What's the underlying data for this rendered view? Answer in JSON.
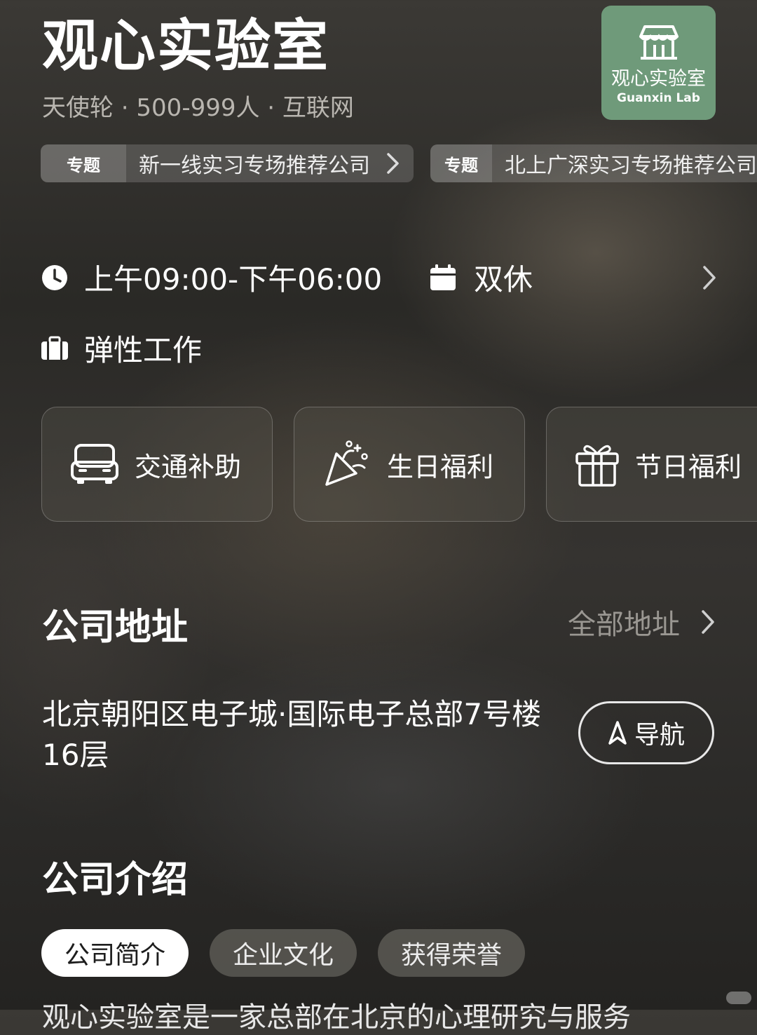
{
  "company": {
    "name": "观心实验室",
    "meta": "天使轮 · 500-999人 · 互联网",
    "logo_cn": "观心实验室",
    "logo_en": "Guanxin Lab"
  },
  "topics": [
    {
      "tag": "专题",
      "text": "新一线实习专场推荐公司"
    },
    {
      "tag": "专题",
      "text": "北上广深实习专场推荐公司"
    }
  ],
  "work": {
    "hours": "上午09:00-下午06:00",
    "days": "双休",
    "mode": "弹性工作"
  },
  "benefits": [
    {
      "label": "交通补助",
      "icon": "car-icon"
    },
    {
      "label": "生日福利",
      "icon": "party-popper-icon"
    },
    {
      "label": "节日福利",
      "icon": "gift-icon"
    }
  ],
  "address_section": {
    "title": "公司地址",
    "all_link": "全部地址",
    "address": "北京朝阳区电子城·国际电子总部7号楼16层",
    "nav_label": "导航"
  },
  "intro_section": {
    "title": "公司介绍",
    "tabs": [
      "公司简介",
      "企业文化",
      "获得荣誉"
    ],
    "text_partial": "观心实验室是一家总部在北京的心理研究与服务"
  },
  "colors": {
    "logo_bg": "#6f9a7a",
    "active_tab_bg": "#ffffff"
  }
}
